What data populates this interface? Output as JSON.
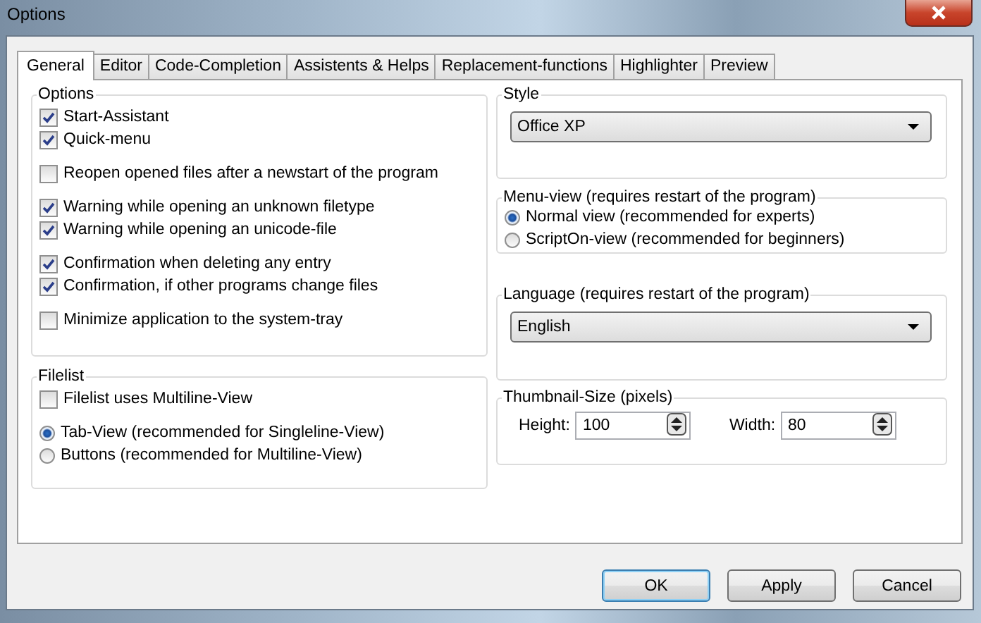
{
  "window": {
    "title": "Options"
  },
  "tabs": [
    {
      "label": "General",
      "selected": true
    },
    {
      "label": "Editor",
      "selected": false
    },
    {
      "label": "Code-Completion",
      "selected": false
    },
    {
      "label": "Assistents & Helps",
      "selected": false
    },
    {
      "label": "Replacement-functions",
      "selected": false
    },
    {
      "label": "Highlighter",
      "selected": false
    },
    {
      "label": "Preview",
      "selected": false
    }
  ],
  "left_groups": [
    {
      "title": "Options",
      "clusters": [
        [
          {
            "kind": "checkbox",
            "label": "Start-Assistant",
            "checked": true
          },
          {
            "kind": "checkbox",
            "label": "Quick-menu",
            "checked": true
          }
        ],
        [
          {
            "kind": "checkbox",
            "label": "Reopen opened files after a newstart of the program",
            "checked": false
          }
        ],
        [
          {
            "kind": "checkbox",
            "label": "Warning while opening an unknown filetype",
            "checked": true
          },
          {
            "kind": "checkbox",
            "label": "Warning while opening an unicode-file",
            "checked": true
          }
        ],
        [
          {
            "kind": "checkbox",
            "label": "Confirmation when deleting any entry",
            "checked": true
          },
          {
            "kind": "checkbox",
            "label": "Confirmation, if other programs change files",
            "checked": true
          }
        ],
        [
          {
            "kind": "checkbox",
            "label": "Minimize application to the system-tray",
            "checked": false
          }
        ]
      ]
    },
    {
      "title": "Filelist",
      "clusters": [
        [
          {
            "kind": "checkbox",
            "label": "Filelist uses Multiline-View",
            "checked": false
          }
        ],
        [
          {
            "kind": "radio",
            "label": "Tab-View (recommended for Singleline-View)",
            "selected": true
          },
          {
            "kind": "radio",
            "label": "Buttons (recommended for Multiline-View)",
            "selected": false
          }
        ]
      ]
    }
  ],
  "right_groups": [
    {
      "title": "Style",
      "kind": "dropdown",
      "value": "Office XP"
    },
    {
      "title": "Menu-view (requires restart of the program)",
      "kind": "radios",
      "options": [
        {
          "label": "Normal view (recommended for experts)",
          "selected": true
        },
        {
          "label": "ScriptOn-view (recommended for beginners)",
          "selected": false
        }
      ]
    },
    {
      "title": "Language (requires restart of the program)",
      "kind": "dropdown",
      "value": "English"
    },
    {
      "title": "Thumbnail-Size (pixels)",
      "kind": "spinners",
      "spinners": [
        {
          "label": "Height:",
          "value": "100"
        },
        {
          "label": "Width:",
          "value": "80"
        }
      ]
    }
  ],
  "buttons": [
    {
      "label": "OK",
      "default": true
    },
    {
      "label": "Apply",
      "default": false
    },
    {
      "label": "Cancel",
      "default": false
    }
  ]
}
